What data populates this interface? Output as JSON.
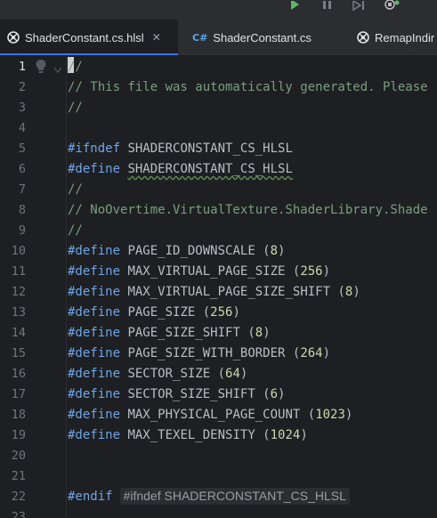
{
  "tabs": [
    {
      "label": "ShaderConstant.cs.hlsl",
      "icon": "hlsl-file-icon",
      "active": true,
      "closable": true
    },
    {
      "label": "ShaderConstant.cs",
      "icon": "csharp-file-icon",
      "icon_text": "C#",
      "active": false
    },
    {
      "label": "RemapIndir",
      "icon": "hlsl-file-icon",
      "active": false
    }
  ],
  "colors": {
    "accent": "#3574f0",
    "comment": "#7a9e7e",
    "keyword": "#6ea6e8",
    "number": "#cfd6ab",
    "identifier": "#bcbec4",
    "run_icon": "#5fb865"
  },
  "editor": {
    "lines": [
      {
        "num": "1",
        "comment": "//"
      },
      {
        "num": "2",
        "comment": "// This file was automatically generated. Please"
      },
      {
        "num": "3",
        "comment": "//"
      },
      {
        "num": "4"
      },
      {
        "num": "5",
        "kw": "#ifndef",
        "name": "SHADERCONSTANT_CS_HLSL"
      },
      {
        "num": "6",
        "kw": "#define",
        "name": "SHADERCONSTANT_CS_HLSL"
      },
      {
        "num": "7",
        "comment": "//"
      },
      {
        "num": "8",
        "comment": "// NoOvertime.VirtualTexture.ShaderLibrary.Shade"
      },
      {
        "num": "9",
        "comment": "//"
      },
      {
        "num": "10",
        "kw": "#define",
        "name": "PAGE_ID_DOWNSCALE",
        "value": "8"
      },
      {
        "num": "11",
        "kw": "#define",
        "name": "MAX_VIRTUAL_PAGE_SIZE",
        "value": "256"
      },
      {
        "num": "12",
        "kw": "#define",
        "name": "MAX_VIRTUAL_PAGE_SIZE_SHIFT",
        "value": "8"
      },
      {
        "num": "13",
        "kw": "#define",
        "name": "PAGE_SIZE",
        "value": "256"
      },
      {
        "num": "14",
        "kw": "#define",
        "name": "PAGE_SIZE_SHIFT",
        "value": "8"
      },
      {
        "num": "15",
        "kw": "#define",
        "name": "PAGE_SIZE_WITH_BORDER",
        "value": "264"
      },
      {
        "num": "16",
        "kw": "#define",
        "name": "SECTOR_SIZE",
        "value": "64"
      },
      {
        "num": "17",
        "kw": "#define",
        "name": "SECTOR_SIZE_SHIFT",
        "value": "6"
      },
      {
        "num": "18",
        "kw": "#define",
        "name": "MAX_PHYSICAL_PAGE_COUNT",
        "value": "1023"
      },
      {
        "num": "19",
        "kw": "#define",
        "name": "MAX_TEXEL_DENSITY",
        "value": "1024"
      },
      {
        "num": "20"
      },
      {
        "num": "21"
      },
      {
        "num": "22",
        "kw": "#endif",
        "hint": "#ifndef SHADERCONSTANT_CS_HLSL"
      },
      {
        "num": "23"
      }
    ]
  }
}
